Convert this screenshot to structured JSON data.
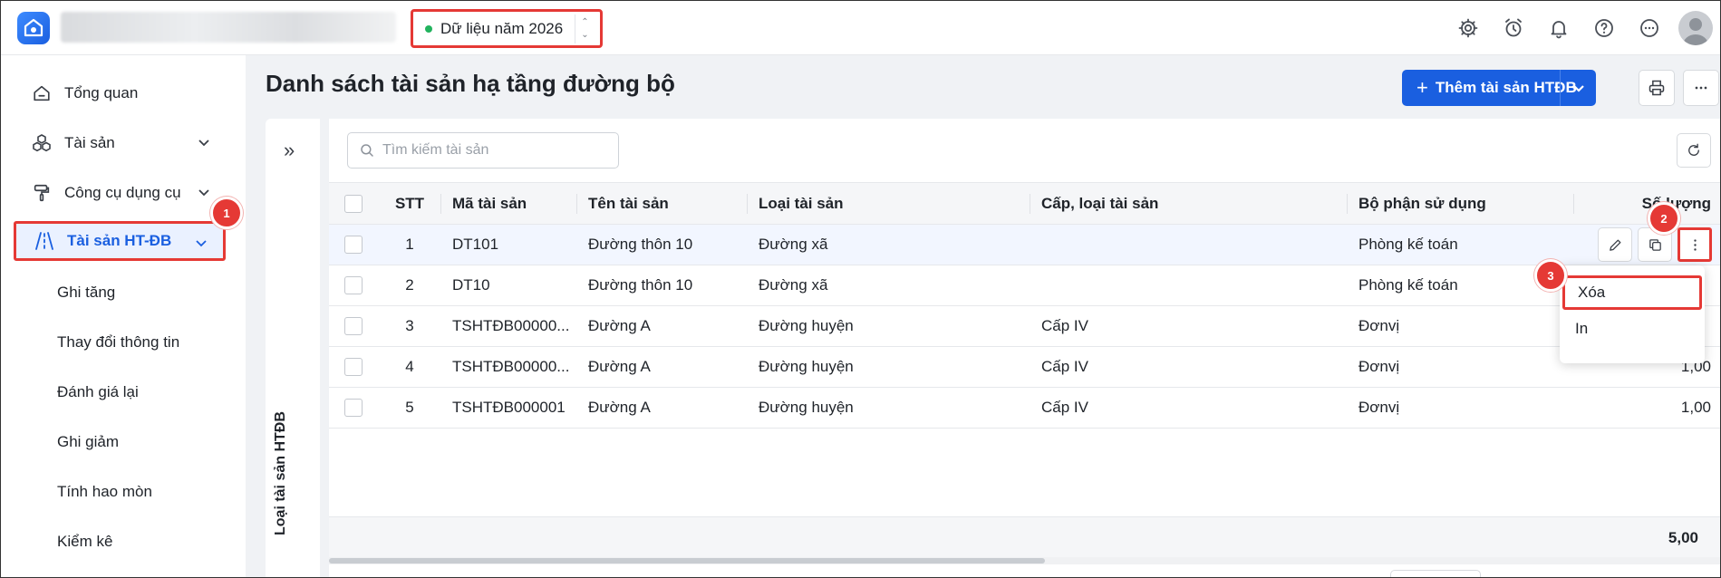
{
  "topbar": {
    "year_label": "Dữ liệu năm 2026",
    "status_color": "#22b35e",
    "icons": [
      "gear-icon",
      "alarm-icon",
      "bell-icon",
      "help-icon",
      "more-icon",
      "avatar"
    ]
  },
  "sidebar": {
    "items": [
      {
        "label": "Tổng quan",
        "icon": "home-icon"
      },
      {
        "label": "Tài sản",
        "icon": "boxes-icon"
      },
      {
        "label": "Công cụ dụng cụ",
        "icon": "tool-icon"
      },
      {
        "label": "Tài sản HT-ĐB",
        "icon": "road-icon",
        "active": true
      }
    ],
    "sub_items": [
      "Ghi tăng",
      "Thay đổi thông tin",
      "Đánh giá lại",
      "Ghi giảm",
      "Tính hao mòn",
      "Kiểm kê"
    ]
  },
  "badges": [
    "1",
    "2",
    "3"
  ],
  "page": {
    "title": "Danh sách tài sản hạ tầng đường bộ",
    "add_button": "Thêm tài sản HTĐB",
    "accent": "#1a5fe0",
    "side_panel_label": "Loại tài sản HTĐB"
  },
  "search": {
    "placeholder": "Tìm kiếm tài sản"
  },
  "table": {
    "headers": [
      "STT",
      "Mã tài sản",
      "Tên tài sản",
      "Loại tài sản",
      "Cấp, loại tài sản",
      "Bộ phận sử dụng",
      "Số lượng"
    ],
    "rows": [
      {
        "stt": "1",
        "code": "DT101",
        "name": "Đường thôn 10",
        "type": "Đường xã",
        "level": "",
        "dept": "Phòng kế toán",
        "qty": ""
      },
      {
        "stt": "2",
        "code": "DT10",
        "name": "Đường thôn 10",
        "type": "Đường xã",
        "level": "",
        "dept": "Phòng kế toán",
        "qty": ""
      },
      {
        "stt": "3",
        "code": "TSHTĐB00000...",
        "name": "Đường A",
        "type": "Đường huyện",
        "level": "Cấp IV",
        "dept": "Đơnvị",
        "qty": ""
      },
      {
        "stt": "4",
        "code": "TSHTĐB00000...",
        "name": "Đường A",
        "type": "Đường huyện",
        "level": "Cấp IV",
        "dept": "Đơnvị",
        "qty": "1,00"
      },
      {
        "stt": "5",
        "code": "TSHTĐB000001",
        "name": "Đường A",
        "type": "Đường huyện",
        "level": "Cấp IV",
        "dept": "Đơnvị",
        "qty": "1,00"
      }
    ],
    "total": "5,00"
  },
  "menu": {
    "items": [
      "Xóa",
      "In"
    ]
  },
  "highlight_color": "#e53935"
}
